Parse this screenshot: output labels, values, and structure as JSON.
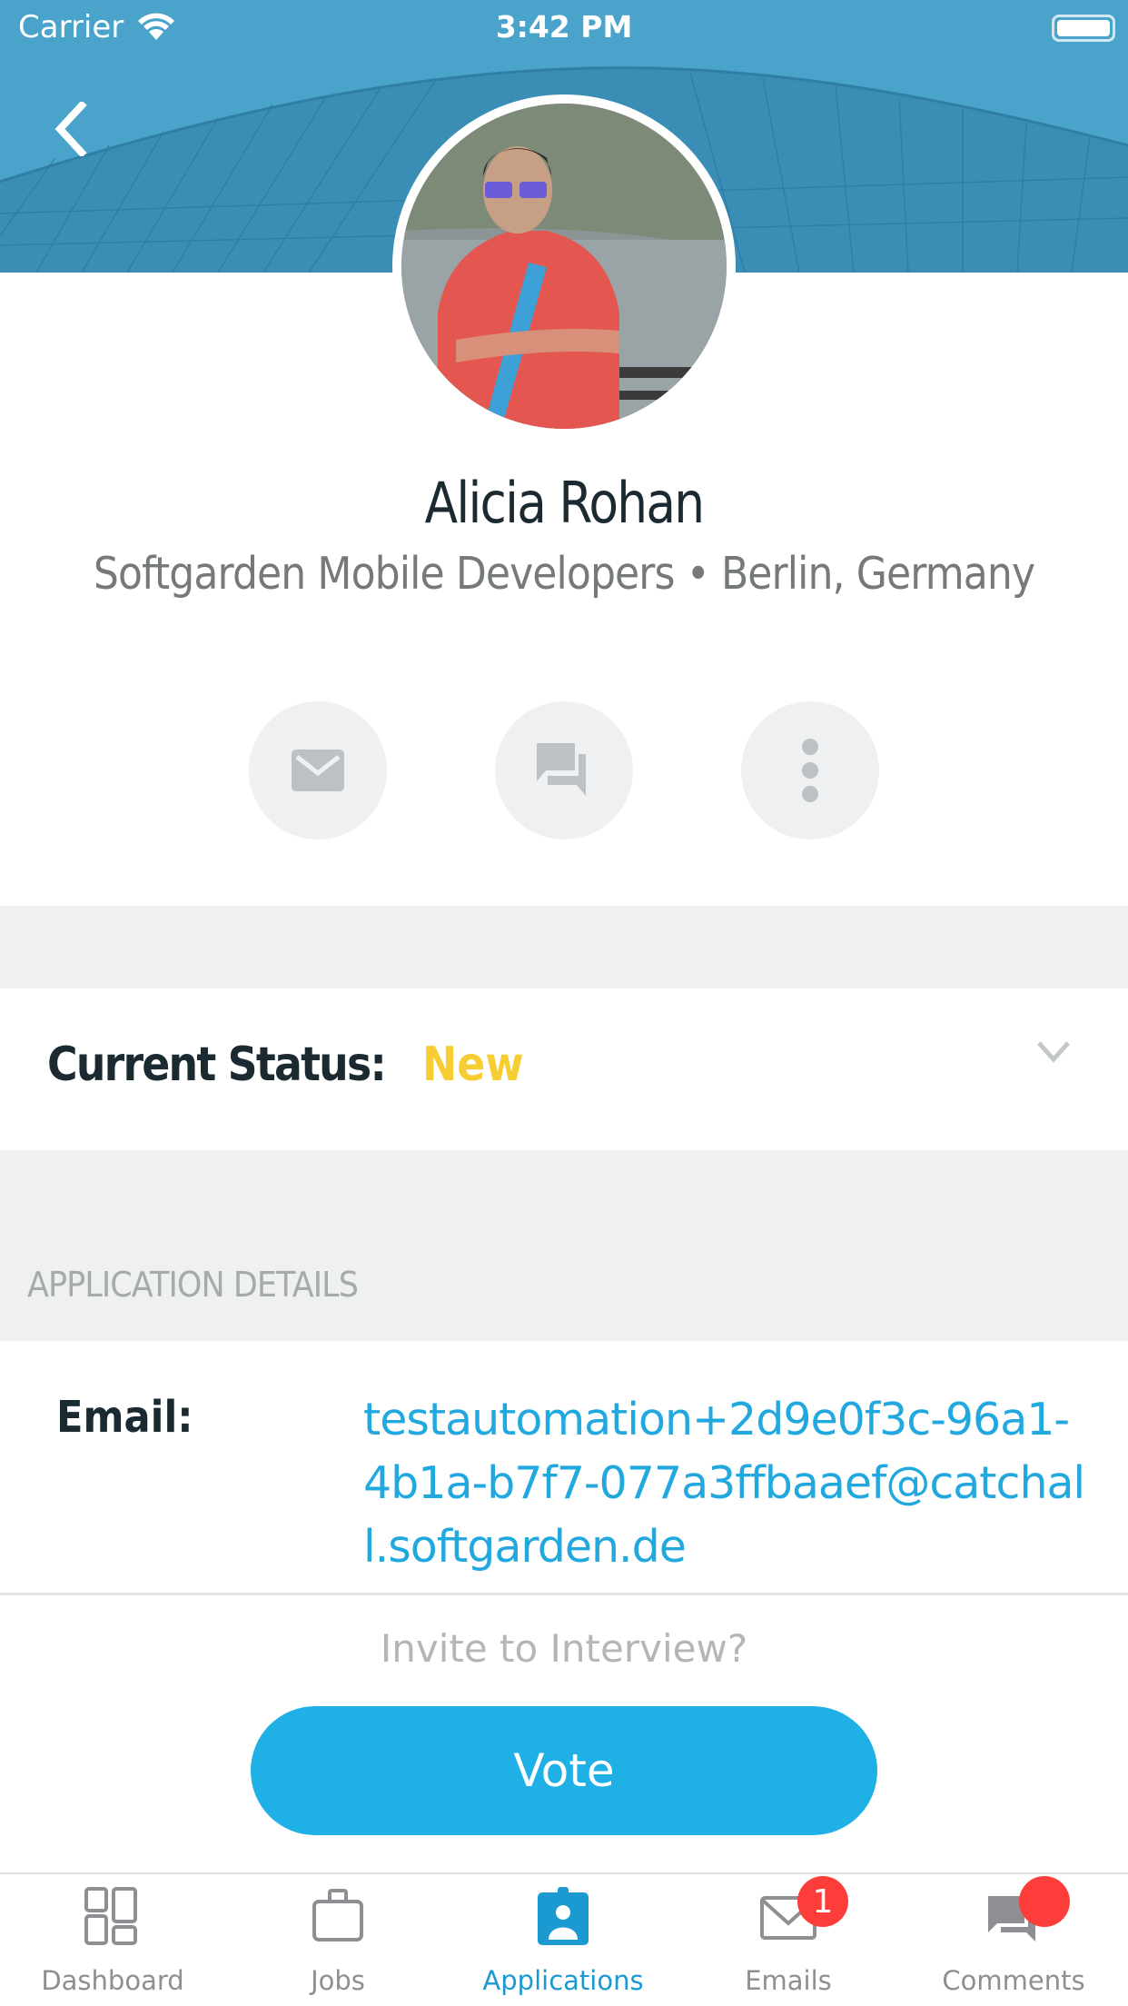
{
  "status_bar": {
    "carrier": "Carrier",
    "time": "3:42 PM"
  },
  "profile": {
    "name": "Alicia Rohan",
    "subtitle": "Softgarden Mobile Developers • Berlin, Germany"
  },
  "actions": [
    {
      "name": "email",
      "icon": "envelope-icon"
    },
    {
      "name": "comment",
      "icon": "chat-bubbles-icon"
    },
    {
      "name": "more",
      "icon": "more-vertical-icon"
    }
  ],
  "status": {
    "label": "Current Status:",
    "value": "New",
    "value_color": "#f6cd33"
  },
  "application_details": {
    "header": "APPLICATION DETAILS",
    "email_label": "Email:",
    "email_value": "testautomation+2d9e0f3c-96a1-4b1a-b7f7-077a3ffbaaef@catchall.softgarden.de"
  },
  "vote_panel": {
    "prompt": "Invite to Interview?",
    "button": "Vote"
  },
  "tabbar": {
    "items": [
      {
        "label": "Dashboard",
        "icon": "dashboard-icon",
        "active": false
      },
      {
        "label": "Jobs",
        "icon": "briefcase-icon",
        "active": false
      },
      {
        "label": "Applications",
        "icon": "id-badge-icon",
        "active": true
      },
      {
        "label": "Emails",
        "icon": "envelope-icon",
        "active": false,
        "badge": "1"
      },
      {
        "label": "Comments",
        "icon": "chat-bubbles-icon",
        "active": false,
        "badge": ""
      }
    ]
  },
  "colors": {
    "accent": "#1fb0e5",
    "header": "#4aa3cb",
    "badge": "#fc3d39",
    "active_tab": "#1b9ad1"
  }
}
